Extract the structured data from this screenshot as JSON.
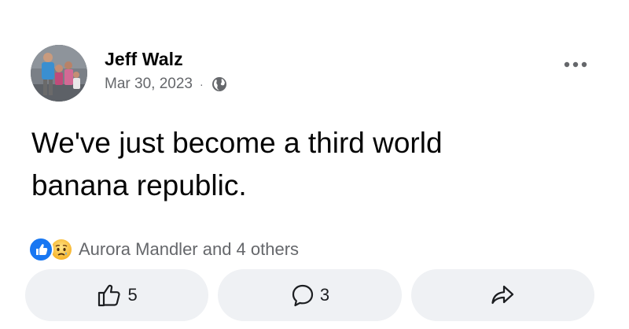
{
  "post": {
    "author": "Jeff Walz",
    "date": "Mar 30, 2023",
    "separator": "·",
    "privacy_icon": "globe-icon",
    "text": "We've just become a third world\nbanana republic.",
    "more_icon": "more-horizontal-icon"
  },
  "reactions": {
    "icons": [
      "like-reaction-icon",
      "sad-reaction-icon"
    ],
    "summary": "Aurora Mandler and 4 others",
    "like_color": "#1877f2"
  },
  "actions": {
    "like": {
      "icon": "thumbs-up-icon",
      "count": "5"
    },
    "comment": {
      "icon": "comment-icon",
      "count": "3"
    },
    "share": {
      "icon": "share-icon"
    }
  },
  "colors": {
    "text_primary": "#050505",
    "text_secondary": "#65676b",
    "button_bg": "#eff1f4"
  }
}
